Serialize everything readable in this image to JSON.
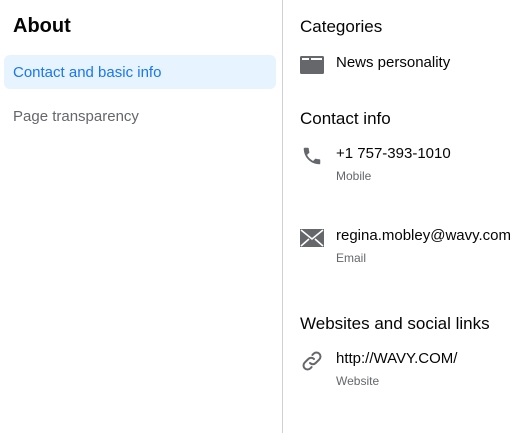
{
  "sidebar": {
    "title": "About",
    "items": [
      {
        "label": "Contact and basic info",
        "active": true
      },
      {
        "label": "Page transparency",
        "active": false
      }
    ]
  },
  "main": {
    "categories": {
      "heading": "Categories",
      "items": [
        {
          "icon": "category-icon",
          "label": "News personality"
        }
      ]
    },
    "contact_info": {
      "heading": "Contact info",
      "phone": {
        "icon": "phone-icon",
        "value": "+1 757-393-1010",
        "type": "Mobile"
      },
      "email": {
        "icon": "envelope-icon",
        "value": "regina.mobley@wavy.com",
        "type": "Email"
      }
    },
    "websites": {
      "heading": "Websites and social links",
      "items": [
        {
          "icon": "link-icon",
          "value": "http://WAVY.COM/",
          "type": "Website"
        }
      ]
    }
  },
  "colors": {
    "accent": "#1877f2",
    "active_bg": "#e7f3ff",
    "secondary_text": "#65676b",
    "icon": "#65676b",
    "divider": "#ced0d4"
  }
}
